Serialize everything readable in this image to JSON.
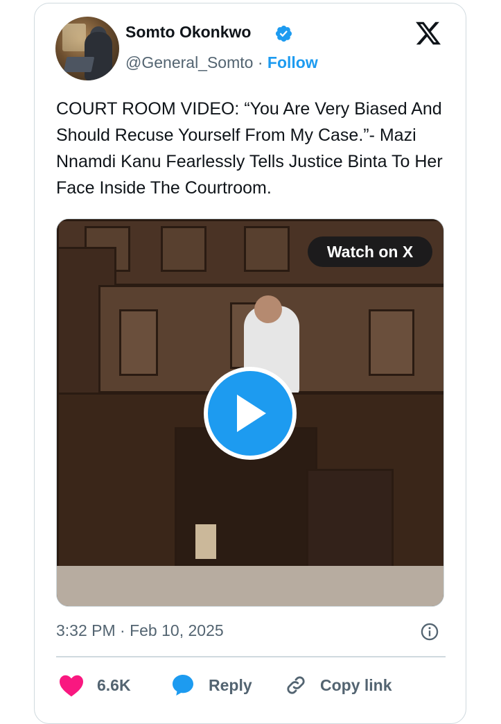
{
  "author": {
    "name": "Somto Okonkwo",
    "handle": "@General_Somto",
    "separator": "·",
    "follow_label": "Follow"
  },
  "tweet": {
    "text": "COURT ROOM VIDEO: “You Are Very Biased And Should Recuse Yourself From My Case.”- Mazi Nnamdi Kanu Fearlessly Tells Justice Binta To Her Face Inside The Courtroom."
  },
  "media": {
    "watch_label": "Watch on X"
  },
  "meta": {
    "timestamp": "3:32 PM · Feb 10, 2025"
  },
  "actions": {
    "likes": "6.6K",
    "reply_label": "Reply",
    "copy_link_label": "Copy link"
  },
  "colors": {
    "accent": "#1d9bf0",
    "like": "#f91880",
    "secondary_text": "#536471",
    "border": "#cfd9de"
  },
  "icons": [
    "verified-badge-icon",
    "x-logo-icon",
    "play-icon",
    "info-icon",
    "heart-icon",
    "reply-bubble-icon",
    "link-icon"
  ]
}
